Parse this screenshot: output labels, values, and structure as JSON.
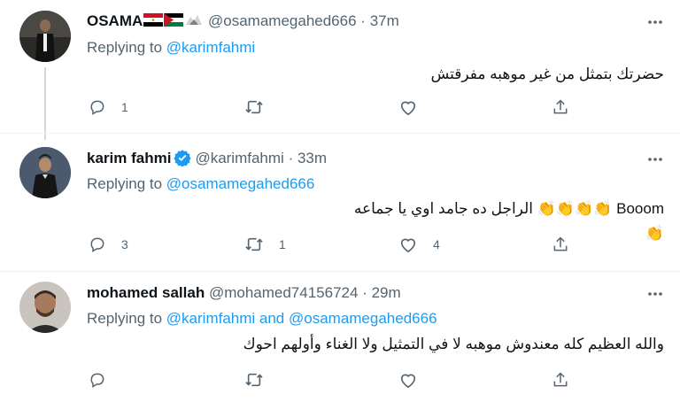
{
  "tweets": [
    {
      "name": "OSAMA",
      "handle": "@osamamegahed666",
      "time": "37m",
      "replying_prefix": "Replying to",
      "replying_to": "@karimfahmi",
      "text": "حضرتك بتمثل من غير موهبه مفرقتش",
      "replies": "1",
      "retweets": "",
      "likes": ""
    },
    {
      "name": "karim fahmi",
      "handle": "@karimfahmi",
      "time": "33m",
      "replying_prefix": "Replying to",
      "replying_to": "@osamamegahed666",
      "text_line1_latin": "Booom",
      "text_line1_arabic": "الراجل ده جامد اوي يا جماعه",
      "clap": "👏",
      "replies": "3",
      "retweets": "1",
      "likes": "4"
    },
    {
      "name": "mohamed sallah",
      "handle": "@mohamed74156724",
      "time": "29m",
      "replying_prefix": "Replying to",
      "replying_to": "@karimfahmi and @osamamegahed666",
      "text": "والله العظيم كله معندوش موهبه لا في التمثيل ولا الغناء وأولهم احوك",
      "replies": "",
      "retweets": "",
      "likes": ""
    }
  ],
  "separator": "·",
  "colors": {
    "accent": "#1d9bf0",
    "secondary": "#536471",
    "text": "#0f1419",
    "divider": "#eff3f4"
  },
  "icons": [
    "reply-icon",
    "retweet-icon",
    "like-icon",
    "share-icon",
    "more-icon",
    "verified-badge-icon",
    "egypt-flag-icon",
    "jordan-flag-icon",
    "eagle-icon"
  ]
}
